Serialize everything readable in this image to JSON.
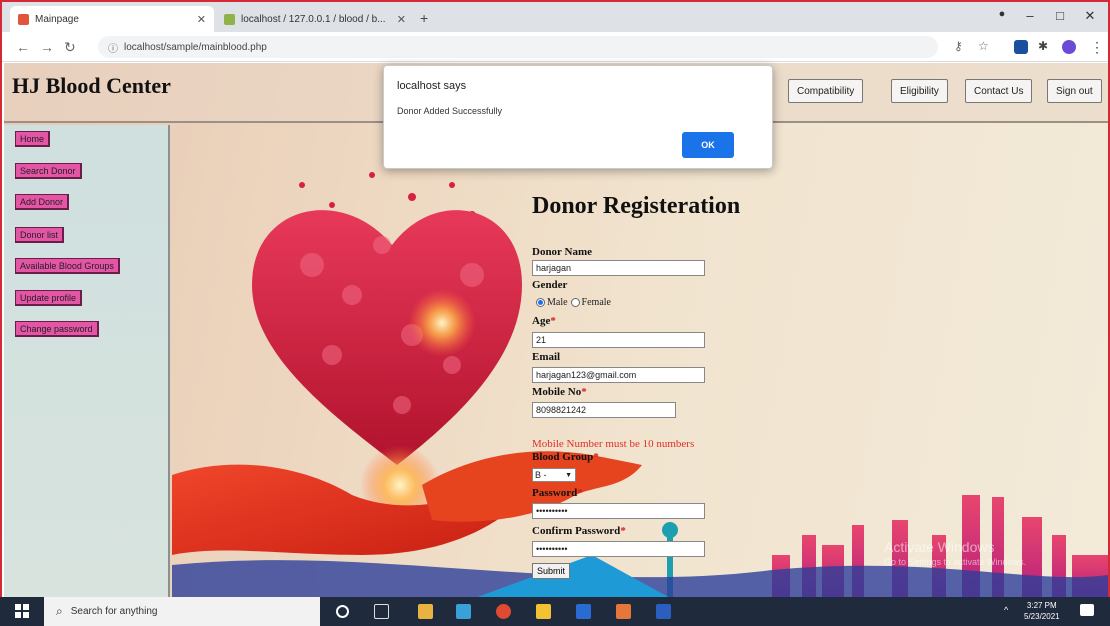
{
  "browser": {
    "tabs": [
      {
        "label": "Mainpage",
        "favicon_color": "#e0553b"
      },
      {
        "label": "localhost / 127.0.0.1 / blood / b...",
        "favicon_color": "#8fb34a"
      }
    ],
    "url": "localhost/sample/mainblood.php"
  },
  "header": {
    "site_title": "HJ Blood Center",
    "buttons": [
      "Compatibility",
      "Eligibility",
      "Contact Us",
      "Sign out"
    ]
  },
  "sidebar": {
    "links": [
      "Home",
      "Search Donor",
      "Add Donor",
      "Donor list",
      "Available Blood Groups",
      "Update profile",
      "Change password"
    ]
  },
  "form": {
    "title": "Donor Registeration",
    "name_label": "Donor Name",
    "name_value": "harjagan",
    "gender_label": "Gender",
    "gender_options": [
      "Male",
      "Female"
    ],
    "gender_selected": "Male",
    "age_label": "Age",
    "age_value": "21",
    "email_label": "Email",
    "email_value": "harjagan123@gmail.com",
    "mobile_label": "Mobile No",
    "mobile_value": "8098821242",
    "mobile_error": "Mobile Number must be 10 numbers",
    "blood_group_label": "Blood Group",
    "blood_group_value": "B -",
    "password_label": "Password",
    "password_value": "••••••••••",
    "confirm_label": "Confirm Password",
    "confirm_value": "••••••••••",
    "submit_label": "Submit",
    "required_mark": "*"
  },
  "alert": {
    "title": "localhost says",
    "message": "Donor Added Successfully",
    "ok_label": "OK"
  },
  "watermark": {
    "title": "Activate Windows",
    "subtitle": "Go to Settings to activate Windows."
  },
  "taskbar": {
    "search_placeholder": "Search for anything",
    "time": "3:27 PM",
    "date": "5/23/2021"
  },
  "colors": {
    "accent": "#1a73e8",
    "sidebar_link": "#e455a6",
    "error": "#e0302a",
    "window_border": "#d42a35"
  }
}
